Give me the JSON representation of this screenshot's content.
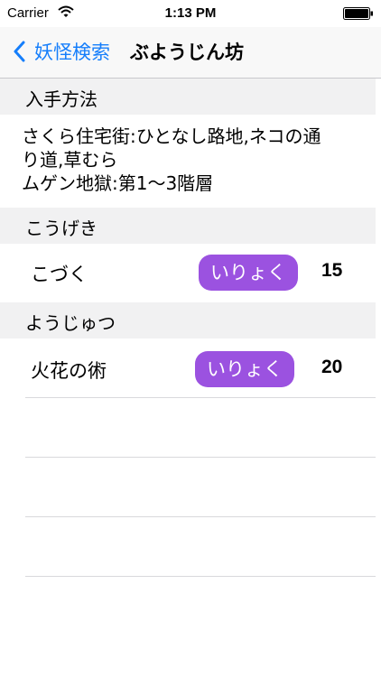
{
  "status": {
    "carrier": "Carrier",
    "time": "1:13 PM"
  },
  "nav": {
    "back_label": "妖怪検索",
    "title": "ぶようじん坊"
  },
  "sections": {
    "obtain": {
      "header": "入手方法",
      "lines": [
        "さくら住宅街:ひとなし路地,ネコの通",
        "り道,草むら",
        "ムゲン地獄:第1〜3階層"
      ]
    },
    "attack": {
      "header": "こうげき",
      "row": {
        "name": "こづく",
        "tag": "いりょく",
        "value": "15"
      }
    },
    "technique": {
      "header": "ようじゅつ",
      "row": {
        "name": "火花の術",
        "tag": "いりょく",
        "value": "20"
      }
    }
  },
  "colors": {
    "accent": "#157efb",
    "tag_purple": "#9b52e0",
    "header_bg": "#f1f1f2"
  },
  "icons": {
    "wifi": "wifi-icon",
    "battery": "battery-icon",
    "back": "chevron-left-icon"
  }
}
